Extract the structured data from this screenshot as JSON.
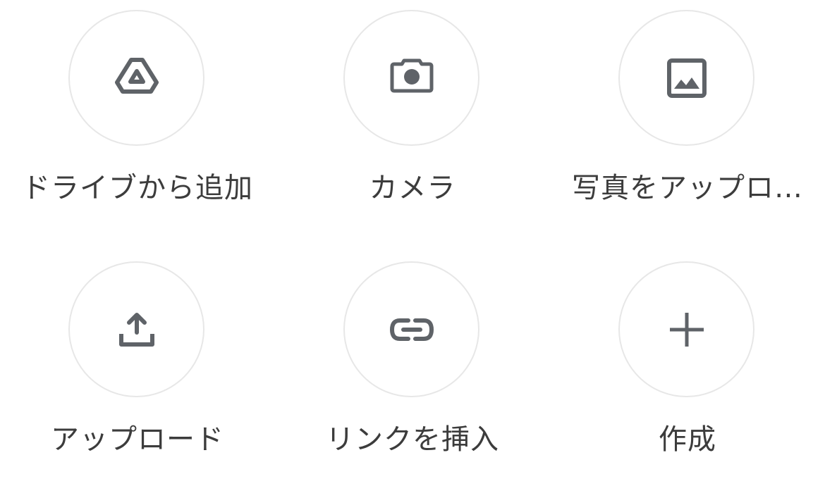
{
  "attachment_menu": {
    "accent_color": "#5f6368",
    "circle_border_color": "#e7e7e7",
    "label_color": "#3c3c3c",
    "items": [
      {
        "label": "ドライブから追加",
        "icon": "drive-icon"
      },
      {
        "label": "カメラ",
        "icon": "camera-icon"
      },
      {
        "label": "写真をアップロ…",
        "icon": "image-icon"
      },
      {
        "label": "アップロード",
        "icon": "upload-icon"
      },
      {
        "label": "リンクを挿入",
        "icon": "link-icon"
      },
      {
        "label": "作成",
        "icon": "plus-icon"
      }
    ]
  }
}
